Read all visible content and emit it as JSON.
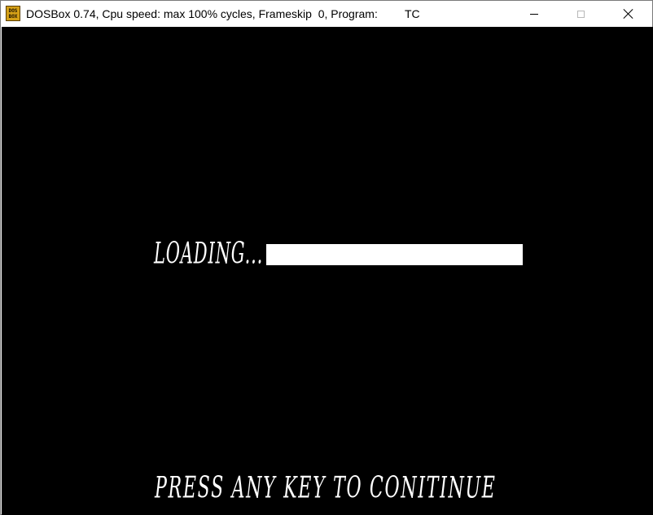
{
  "window": {
    "title": "DOSBox 0.74, Cpu speed: max 100% cycles, Frameskip  0, Program:",
    "program": "TC",
    "icon_top": "DOS",
    "icon_bottom": "BOX",
    "icon": "dosbox-icon",
    "controls": {
      "minimize": "minimize-icon",
      "maximize": "maximize-icon",
      "close": "close-icon"
    }
  },
  "screen": {
    "background": "#000000",
    "foreground": "#ffffff",
    "loading_label": "LOADING...",
    "loading_progress": 1.0,
    "prompt": "PRESS ANY KEY TO CONITINUE"
  }
}
